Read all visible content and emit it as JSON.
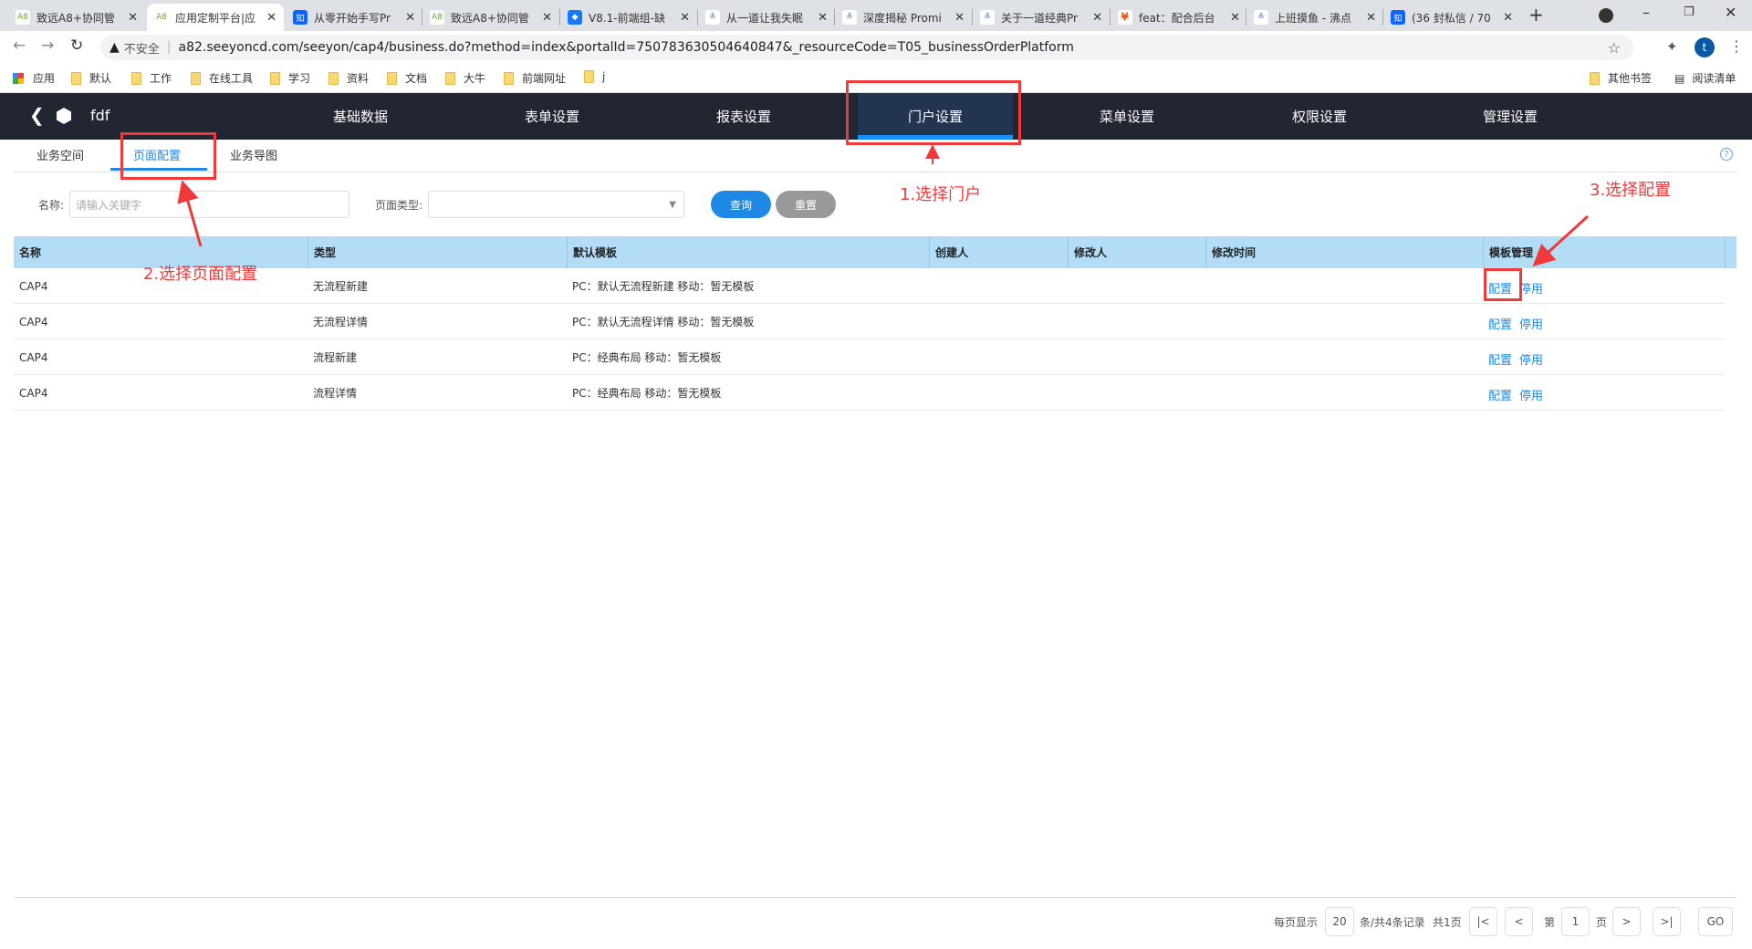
{
  "browser": {
    "tabs": [
      {
        "label": "致远A8+协同管",
        "icon": "a8-icon",
        "active": false
      },
      {
        "label": "应用定制平台|应",
        "icon": "a8-icon",
        "active": true
      },
      {
        "label": "从零开始手写Pr",
        "icon": "zhihu-icon",
        "active": false
      },
      {
        "label": "致远A8+协同管",
        "icon": "a8-icon",
        "active": false
      },
      {
        "label": "V8.1-前端组-缺",
        "icon": "diamond-icon",
        "active": false
      },
      {
        "label": "从一道让我失眠",
        "icon": "juejin-icon",
        "active": false
      },
      {
        "label": "深度揭秘 Promi",
        "icon": "juejin-icon",
        "active": false
      },
      {
        "label": "关于一道经典Pr",
        "icon": "juejin-icon",
        "active": false
      },
      {
        "label": "feat：配合后台",
        "icon": "gitlab-icon",
        "active": false
      },
      {
        "label": "上班摸鱼 - 沸点",
        "icon": "juejin-icon",
        "active": false
      },
      {
        "label": "(36 封私信 / 70",
        "icon": "zhihu-icon",
        "active": false
      }
    ],
    "security_label": "不安全",
    "url": "a82.seeyoncd.com/seeyon/cap4/business.do?method=index&portalId=750783630504640847&_resourceCode=T05_businessOrderPlatform",
    "profile_initial": "t",
    "bookmarks": [
      "应用",
      "默认",
      "工作",
      "在线工具",
      "学习",
      "资料",
      "文档",
      "大牛",
      "前端网址",
      "j"
    ],
    "other_bookmarks": "其他书签",
    "reading_list": "阅读清单"
  },
  "app": {
    "name": "fdf",
    "nav": [
      "基础数据",
      "表单设置",
      "报表设置",
      "门户设置",
      "菜单设置",
      "权限设置",
      "管理设置"
    ],
    "active_nav": 3,
    "subtabs": [
      "业务空间",
      "页面配置",
      "业务导图"
    ],
    "active_subtab": 1,
    "help": "?"
  },
  "filter": {
    "name_label": "名称:",
    "name_placeholder": "请输入关键字",
    "type_label": "页面类型:",
    "type_value": "",
    "query": "查询",
    "reset": "重置"
  },
  "table": {
    "columns": [
      "名称",
      "类型",
      "默认模板",
      "创建人",
      "修改人",
      "修改时间",
      "模板管理"
    ],
    "rows": [
      {
        "name": "CAP4",
        "type": "无流程新建",
        "template": "PC：默认无流程新建   移动：暂无模板",
        "creator": "",
        "modifier": "",
        "time": "",
        "actions": [
          "配置",
          "停用"
        ]
      },
      {
        "name": "CAP4",
        "type": "无流程详情",
        "template": "PC：默认无流程详情   移动：暂无模板",
        "creator": "",
        "modifier": "",
        "time": "",
        "actions": [
          "配置",
          "停用"
        ]
      },
      {
        "name": "CAP4",
        "type": "流程新建",
        "template": "PC：经典布局   移动：暂无模板",
        "creator": "",
        "modifier": "",
        "time": "",
        "actions": [
          "配置",
          "停用"
        ]
      },
      {
        "name": "CAP4",
        "type": "流程详情",
        "template": "PC：经典布局   移动：暂无模板",
        "creator": "",
        "modifier": "",
        "time": "",
        "actions": [
          "配置",
          "停用"
        ]
      }
    ]
  },
  "pagination": {
    "per_page_label": "每页显示",
    "per_page": "20",
    "records": "条/共4条记录",
    "pages": "共1页",
    "page_prefix": "第",
    "page": "1",
    "page_suffix": "页",
    "go": "GO"
  },
  "annotations": [
    "1.选择门户",
    "2.选择页面配置",
    "3.选择配置"
  ],
  "colors": {
    "header": "#222632",
    "active_nav": "#22344f",
    "accent": "#1e88e5",
    "table_header": "#b3dcf7",
    "annotation": "#f03a3a"
  }
}
